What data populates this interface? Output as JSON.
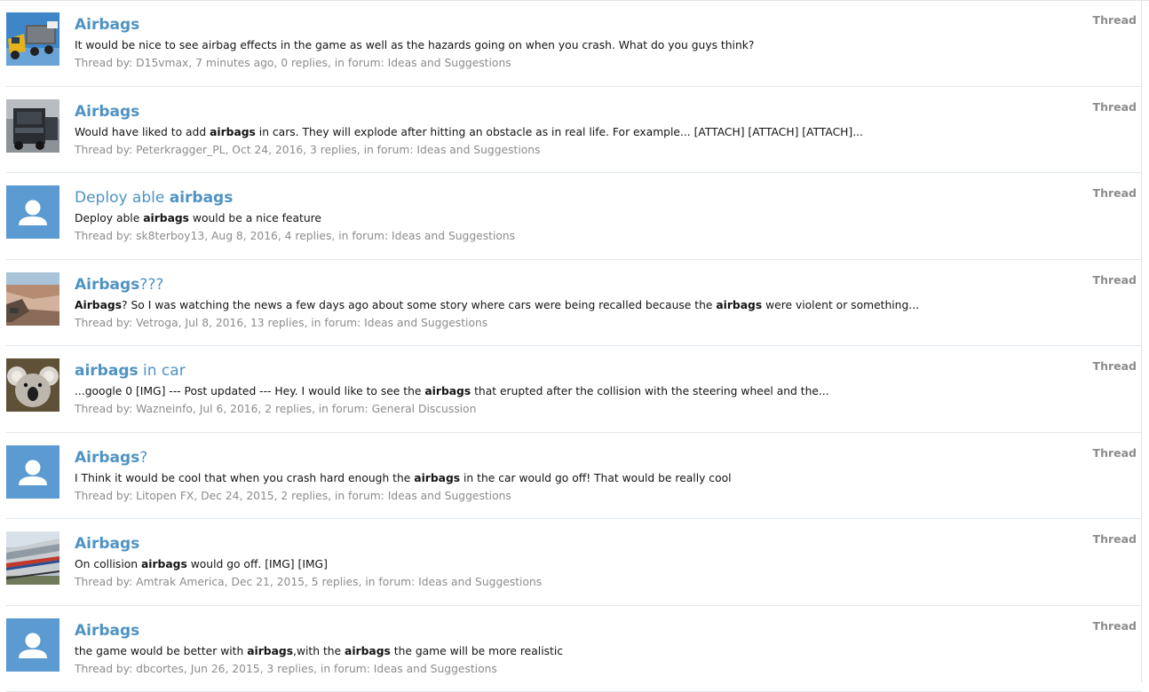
{
  "colors": {
    "link": "#4e93c4",
    "meta": "#8c8c8c",
    "avatar_default": "#5b9bd1"
  },
  "results": [
    {
      "title": [
        {
          "t": "Airbags",
          "b": true
        }
      ],
      "snippet": [
        {
          "t": "It would be nice to see airbag effects in the game as well as the hazards going on when you crash. What do you guys think?",
          "b": false
        }
      ],
      "meta": "Thread by: D15vmax, 7 minutes ago, 0 replies, in forum: Ideas and Suggestions",
      "type": "Thread",
      "avatar": "truck-photo"
    },
    {
      "title": [
        {
          "t": "Airbags",
          "b": true
        }
      ],
      "snippet": [
        {
          "t": "Would have liked to add ",
          "b": false
        },
        {
          "t": "airbags",
          "b": true
        },
        {
          "t": " in cars. They will explode after hitting an obstacle as in real life. For example... [ATTACH] [ATTACH] [ATTACH]...",
          "b": false
        }
      ],
      "meta": "Thread by: Peterkragger_PL, Oct 24, 2016, 3 replies, in forum: Ideas and Suggestions",
      "type": "Thread",
      "avatar": "dark-truck-photo"
    },
    {
      "title": [
        {
          "t": "Deploy able ",
          "b": false
        },
        {
          "t": "airbags",
          "b": true
        }
      ],
      "snippet": [
        {
          "t": "Deploy able ",
          "b": false
        },
        {
          "t": "airbags",
          "b": true
        },
        {
          "t": " would be a nice feature",
          "b": false
        }
      ],
      "meta": "Thread by: sk8terboy13, Aug 8, 2016, 4 replies, in forum: Ideas and Suggestions",
      "type": "Thread",
      "avatar": "default"
    },
    {
      "title": [
        {
          "t": "Airbags",
          "b": true
        },
        {
          "t": "???",
          "b": false
        }
      ],
      "snippet": [
        {
          "t": "Airbags",
          "b": true
        },
        {
          "t": "? So I was watching the news a few days ago about some story where cars were being recalled because the ",
          "b": false
        },
        {
          "t": "airbags",
          "b": true
        },
        {
          "t": " were violent or something...",
          "b": false
        }
      ],
      "meta": "Thread by: Vetroga, Jul 8, 2016, 13 replies, in forum: Ideas and Suggestions",
      "type": "Thread",
      "avatar": "canyon-photo"
    },
    {
      "title": [
        {
          "t": "airbags",
          "b": true
        },
        {
          "t": " in car",
          "b": false
        }
      ],
      "snippet": [
        {
          "t": "...google 0 [IMG] --- Post updated --- Hey. I would like to see the ",
          "b": false
        },
        {
          "t": "airbags",
          "b": true
        },
        {
          "t": " that erupted after the collision with the steering wheel and the...",
          "b": false
        }
      ],
      "meta": "Thread by: Wazneinfo, Jul 6, 2016, 2 replies, in forum: General Discussion",
      "type": "Thread",
      "avatar": "koala-photo"
    },
    {
      "title": [
        {
          "t": "Airbags",
          "b": true
        },
        {
          "t": "?",
          "b": false
        }
      ],
      "snippet": [
        {
          "t": "I Think it would be cool that when you crash hard enough the ",
          "b": false
        },
        {
          "t": "airbags",
          "b": true
        },
        {
          "t": " in the car would go off! That would be really cool",
          "b": false
        }
      ],
      "meta": "Thread by: Litopen FX, Dec 24, 2015, 2 replies, in forum: Ideas and Suggestions",
      "type": "Thread",
      "avatar": "default"
    },
    {
      "title": [
        {
          "t": "Airbags",
          "b": true
        }
      ],
      "snippet": [
        {
          "t": "On collision ",
          "b": false
        },
        {
          "t": "airbags",
          "b": true
        },
        {
          "t": " would go off. [IMG] [IMG]",
          "b": false
        }
      ],
      "meta": "Thread by: Amtrak America, Dec 21, 2015, 5 replies, in forum: Ideas and Suggestions",
      "type": "Thread",
      "avatar": "train-photo"
    },
    {
      "title": [
        {
          "t": "Airbags",
          "b": true
        }
      ],
      "snippet": [
        {
          "t": "the game would be better with ",
          "b": false
        },
        {
          "t": "airbags",
          "b": true
        },
        {
          "t": ",with the ",
          "b": false
        },
        {
          "t": "airbags",
          "b": true
        },
        {
          "t": " the game will be more realistic",
          "b": false
        }
      ],
      "meta": "Thread by: dbcortes, Jun 26, 2015, 3 replies, in forum: Ideas and Suggestions",
      "type": "Thread",
      "avatar": "default"
    }
  ]
}
